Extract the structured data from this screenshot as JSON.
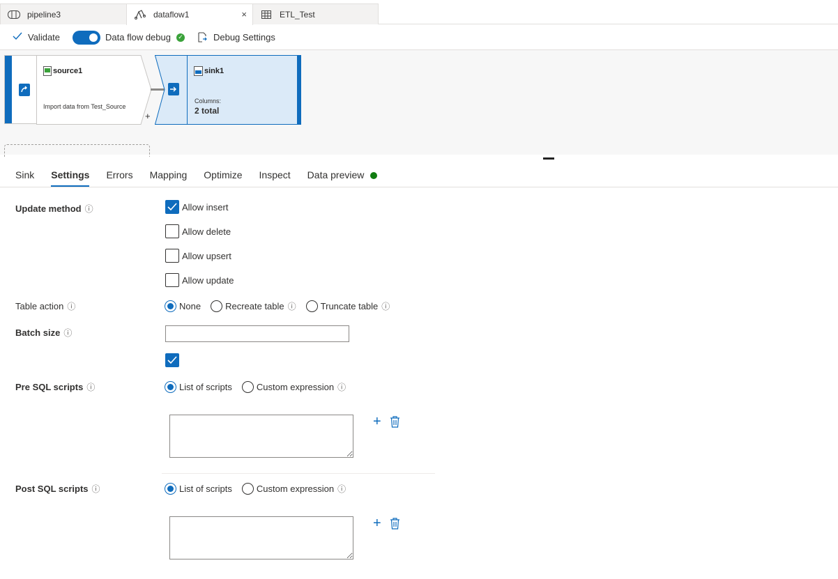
{
  "tabs": [
    {
      "label": "pipeline3",
      "icon": "pipeline-icon",
      "active": false
    },
    {
      "label": "dataflow1",
      "icon": "dataflow-icon",
      "active": true
    },
    {
      "label": "ETL_Test",
      "icon": "table-icon",
      "active": false
    }
  ],
  "toolbar": {
    "validate_label": "Validate",
    "debug_label": "Data flow debug",
    "debug_on": true,
    "debug_settings_label": "Debug Settings"
  },
  "canvas": {
    "source": {
      "name": "source1",
      "description": "Import data from Test_Source"
    },
    "sink": {
      "name": "sink1",
      "columns_label": "Columns:",
      "columns_value": "2 total"
    },
    "add_label": "+"
  },
  "property_tabs": [
    "Sink",
    "Settings",
    "Errors",
    "Mapping",
    "Optimize",
    "Inspect",
    "Data preview"
  ],
  "active_tab": "Settings",
  "form": {
    "update_method": {
      "label": "Update method",
      "options": [
        {
          "label": "Allow insert",
          "checked": true
        },
        {
          "label": "Allow delete",
          "checked": false
        },
        {
          "label": "Allow upsert",
          "checked": false
        },
        {
          "label": "Allow update",
          "checked": false
        }
      ]
    },
    "table_action": {
      "label": "Table action",
      "options": [
        "None",
        "Recreate table",
        "Truncate table"
      ],
      "selected": "None"
    },
    "batch_size": {
      "label": "Batch size",
      "value": ""
    },
    "extra_checkbox_checked": true,
    "pre_sql": {
      "label": "Pre SQL scripts",
      "options": [
        "List of scripts",
        "Custom expression"
      ],
      "selected": "List of scripts",
      "script": ""
    },
    "post_sql": {
      "label": "Post SQL scripts",
      "options": [
        "List of scripts",
        "Custom expression"
      ],
      "selected": "List of scripts",
      "script": ""
    }
  },
  "icons": {
    "info": "ⓘ",
    "add": "+",
    "delete": "trash-icon",
    "close": "×"
  },
  "colors": {
    "accent": "#0f6cbd",
    "status_ok": "#3aa23a",
    "preview_dot": "#107c10"
  }
}
